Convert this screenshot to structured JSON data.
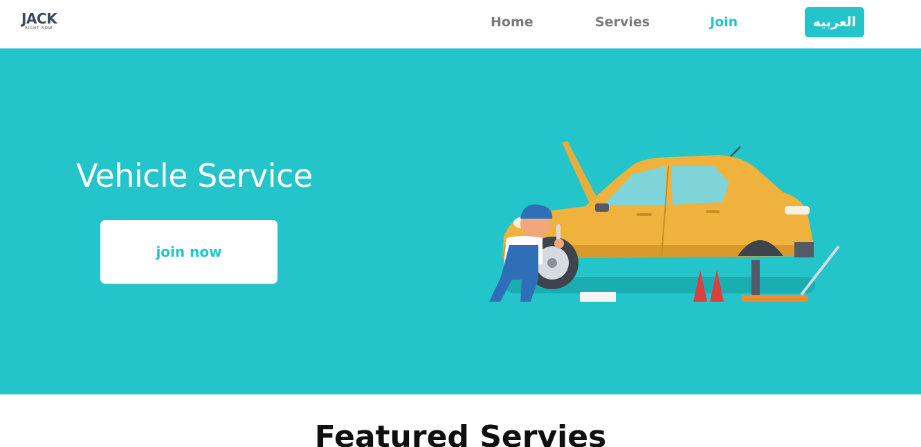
{
  "brand": {
    "name": "JACK",
    "tagline": "RIGHT NOW"
  },
  "nav": {
    "items": [
      {
        "label": "Home",
        "active": false
      },
      {
        "label": "Servies",
        "active": false
      },
      {
        "label": "Join",
        "active": true
      }
    ],
    "language_button": "العربيه"
  },
  "hero": {
    "title": "Vehicle Service",
    "cta_label": "join now",
    "illustration": "mechanic-repairing-car-illustration"
  },
  "featured": {
    "title": "Featured Servies"
  },
  "colors": {
    "accent": "#24c5ca",
    "nav_text": "#7a7a7a",
    "logo": "#3f4a59",
    "white": "#ffffff"
  }
}
